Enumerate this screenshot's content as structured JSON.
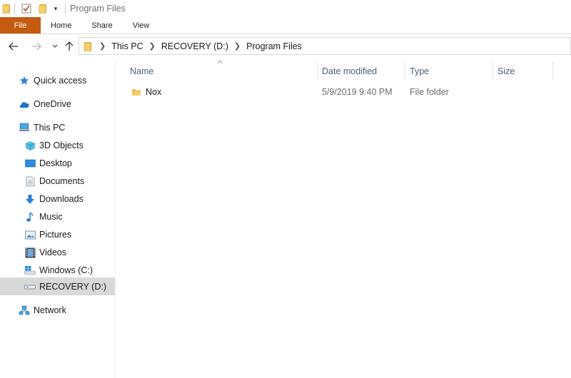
{
  "window": {
    "title": "Program Files"
  },
  "ribbon": {
    "tabs": [
      "File",
      "Home",
      "Share",
      "View"
    ]
  },
  "address": {
    "crumbs": [
      "This PC",
      "RECOVERY (D:)",
      "Program Files"
    ]
  },
  "sidebar": {
    "items": [
      {
        "label": "Quick access",
        "icon": "star-icon"
      },
      {
        "label": "OneDrive",
        "icon": "cloud-icon"
      },
      {
        "label": "This PC",
        "icon": "computer-icon"
      },
      {
        "label": "3D Objects",
        "icon": "cube-icon"
      },
      {
        "label": "Desktop",
        "icon": "desktop-icon"
      },
      {
        "label": "Documents",
        "icon": "document-icon"
      },
      {
        "label": "Downloads",
        "icon": "download-icon"
      },
      {
        "label": "Music",
        "icon": "music-note-icon"
      },
      {
        "label": "Pictures",
        "icon": "picture-icon"
      },
      {
        "label": "Videos",
        "icon": "film-icon"
      },
      {
        "label": "Windows (C:)",
        "icon": "drive-windows-icon"
      },
      {
        "label": "RECOVERY (D:)",
        "icon": "drive-icon",
        "selected": true
      },
      {
        "label": "Network",
        "icon": "network-icon"
      }
    ]
  },
  "columns": {
    "name": "Name",
    "date": "Date modified",
    "type": "Type",
    "size": "Size"
  },
  "files": [
    {
      "name": "Nox",
      "date": "5/9/2019 9:40 PM",
      "type": "File folder",
      "size": ""
    }
  ],
  "colors": {
    "file_tab": "#c55a11",
    "selected_bg": "#d9d9d9",
    "folder": "#e8b54a",
    "header_text": "#4c607a"
  }
}
